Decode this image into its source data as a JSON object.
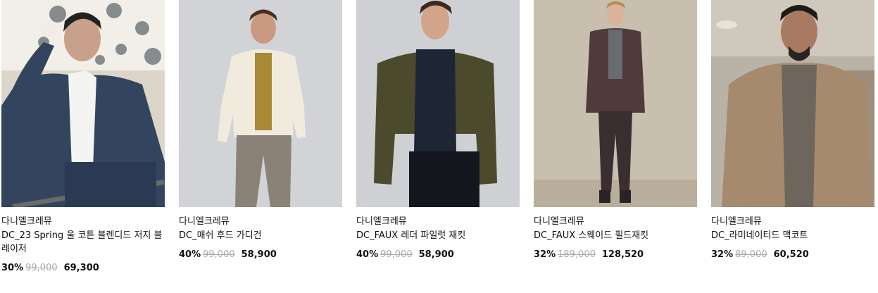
{
  "products": [
    {
      "brand": "다니엘크레뮤",
      "name": "DC_23 Spring 울 코튼 블렌디드 저지 블레이저",
      "discount": "30%",
      "original_price": "99,000",
      "sale_price": "69,300"
    },
    {
      "brand": "다니엘크레뮤",
      "name": "DC_매쉬 후드 가디건",
      "discount": "40%",
      "original_price": "99,000",
      "sale_price": "58,900"
    },
    {
      "brand": "다니엘크레뮤",
      "name": "DC_FAUX 레더 파일럿 재킷",
      "discount": "40%",
      "original_price": "99,000",
      "sale_price": "58,900"
    },
    {
      "brand": "다니엘크레뮤",
      "name": "DC_FAUX 스웨이드 필드재킷",
      "discount": "32%",
      "original_price": "189,000",
      "sale_price": "128,520"
    },
    {
      "brand": "다니엘크레뮤",
      "name": "DC_라미네이티드 맥코트",
      "discount": "32%",
      "original_price": "89,000",
      "sale_price": "60,520"
    }
  ]
}
